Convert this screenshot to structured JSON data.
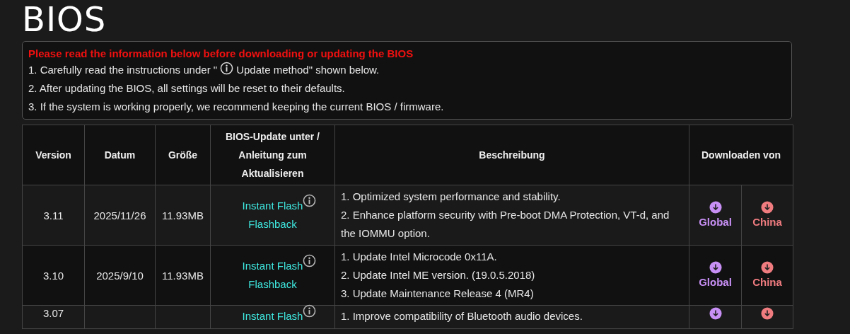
{
  "title": "BIOS",
  "notice": {
    "heading": "Please read the information below before downloading or updating the BIOS",
    "lines": [
      {
        "kind": "with_icon",
        "before": "1. Carefully read the instructions under \"",
        "after": "Update method\" shown below."
      },
      {
        "kind": "plain",
        "text": "2. After updating the BIOS, all settings will be reset to their defaults."
      },
      {
        "kind": "plain",
        "text": "3. If the system is working properly, we recommend keeping the current BIOS / firmware."
      }
    ]
  },
  "table": {
    "columns": [
      "Version",
      "Datum",
      "Größe",
      "BIOS-Update unter / Anleitung zum Aktualisieren",
      "Beschreibung",
      "Downloaden von"
    ],
    "rows": [
      {
        "version": "3.11",
        "date": "2025/11/26",
        "size": "11.93MB",
        "methods": [
          "Instant Flash",
          "Flashback"
        ],
        "description": [
          "1. Optimized system performance and stability.",
          "2. Enhance platform security with Pre-boot DMA Protection, VT-d, and the IOMMU option."
        ],
        "downloads": [
          {
            "label": "Global",
            "color": "#c890f5"
          },
          {
            "label": "China",
            "color": "#f07c80"
          }
        ]
      },
      {
        "version": "3.10",
        "date": "2025/9/10",
        "size": "11.93MB",
        "methods": [
          "Instant Flash",
          "Flashback"
        ],
        "description": [
          "1. Update Intel Microcode 0x11A.",
          "2. Update Intel ME version. (19.0.5.2018)",
          "3. Update Maintenance Release 4 (MR4)"
        ],
        "downloads": [
          {
            "label": "Global",
            "color": "#c890f5"
          },
          {
            "label": "China",
            "color": "#f07c80"
          }
        ]
      },
      {
        "version": "3.07",
        "methods": [
          "Instant Flash"
        ],
        "description": [
          "1. Improve compatibility of Bluetooth audio devices."
        ],
        "downloads": [
          {
            "color": "#c890f5"
          },
          {
            "color": "#f07c80"
          }
        ]
      }
    ]
  }
}
